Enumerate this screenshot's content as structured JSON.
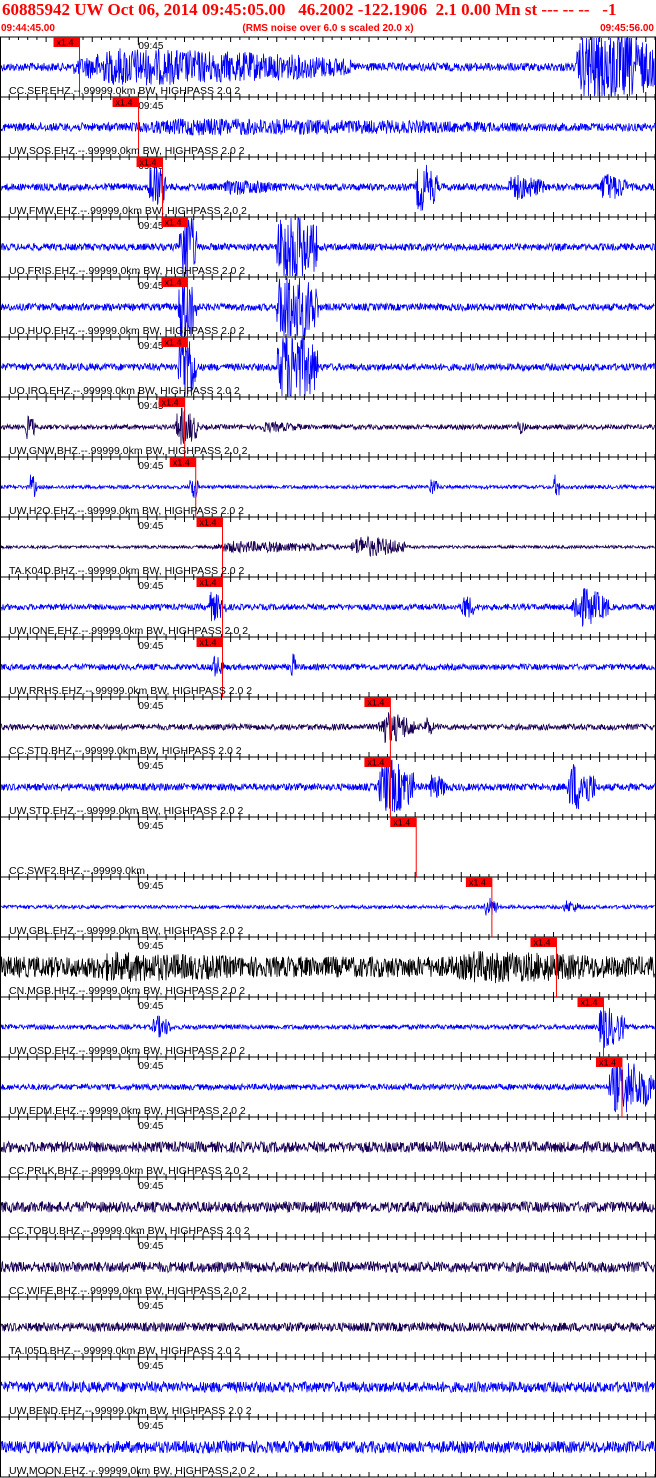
{
  "header": {
    "title": "60885942 UW Oct 06, 2014 09:45:05.00   46.2002 -122.1906  2.1 0.00 Mn st --- -- --   -1",
    "start_time": "09:44:45.00",
    "rms_note": "(RMS noise over 6.0 s scaled 20.0 x)",
    "end_time": "09:45:56.00"
  },
  "colors": {
    "header_text": "#ff0000",
    "pick_marker": "#ff0000",
    "axis": "#000000"
  },
  "chart_data": {
    "type": "line",
    "x_range_seconds": [
      0,
      71
    ],
    "minute_mark_label": "09:45",
    "minute_mark_seconds": 15,
    "pick_label": "x1.4",
    "traces": [
      {
        "label": "CC.SEP.EHZ.--.99999.0km BW, HIGHPASS  2.0  2",
        "color": "#0000ff",
        "pick_s": 5.8,
        "baseline_amp": 0.14,
        "bursts": [
          {
            "t": 8,
            "dur": 30,
            "amp": 0.7
          },
          {
            "t": 62.5,
            "dur": 8.5,
            "amp": 1.6
          }
        ]
      },
      {
        "label": "UW.SOS.EHZ.--.99999.0km BW, HIGHPASS  2.0  2",
        "color": "#0000ff",
        "pick_s": 12.2,
        "baseline_amp": 0.14,
        "bursts": [
          {
            "t": 13,
            "dur": 45,
            "amp": 0.32
          }
        ]
      },
      {
        "label": "UW.FMW.EHZ.--.99999.0km BW, HIGHPASS  2.0  2",
        "color": "#0000ff",
        "pick_s": 14.8,
        "baseline_amp": 0.12,
        "bursts": [
          {
            "t": 16,
            "dur": 2,
            "amp": 1.0
          },
          {
            "t": 24,
            "dur": 7,
            "amp": 0.3
          },
          {
            "t": 45,
            "dur": 2.5,
            "amp": 0.95
          },
          {
            "t": 55,
            "dur": 4,
            "amp": 0.5
          },
          {
            "t": 65,
            "dur": 3,
            "amp": 0.55
          }
        ]
      },
      {
        "label": "UO.FRIS.EHZ.--.99999.0km BW, HIGHPASS  2.0  2",
        "color": "#0000ff",
        "pick_s": 17.5,
        "baseline_amp": 0.12,
        "bursts": [
          {
            "t": 19.3,
            "dur": 2,
            "amp": 1.6
          },
          {
            "t": 30,
            "dur": 4.5,
            "amp": 1.6
          }
        ]
      },
      {
        "label": "UO.HUO.EHZ.--.99999.0km BW, HIGHPASS  2.0  2",
        "color": "#0000ff",
        "pick_s": 17.5,
        "baseline_amp": 0.12,
        "bursts": [
          {
            "t": 19.3,
            "dur": 2,
            "amp": 1.6
          },
          {
            "t": 30,
            "dur": 4.5,
            "amp": 1.6
          }
        ]
      },
      {
        "label": "UO.IRO.EHZ.--.99999.0km BW, HIGHPASS  2.0  2",
        "color": "#0000ff",
        "pick_s": 17.5,
        "baseline_amp": 0.12,
        "bursts": [
          {
            "t": 19.3,
            "dur": 2,
            "amp": 1.6
          },
          {
            "t": 30,
            "dur": 4.5,
            "amp": 1.6
          }
        ]
      },
      {
        "label": "UW.GNW.BHZ.--.99999.0km BW, HIGHPASS  2.0  2",
        "color": "#1a0055",
        "pick_s": 17.2,
        "baseline_amp": 0.08,
        "bursts": [
          {
            "t": 2.8,
            "dur": 1,
            "amp": 0.5
          },
          {
            "t": 19,
            "dur": 2.5,
            "amp": 0.75
          },
          {
            "t": 28,
            "dur": 5,
            "amp": 0.2
          },
          {
            "t": 56,
            "dur": 1,
            "amp": 0.3
          }
        ]
      },
      {
        "label": "UW.H2O.EHZ.--.99999.0km BW, HIGHPASS  2.0  2",
        "color": "#0000ff",
        "pick_s": 18.4,
        "baseline_amp": 0.06,
        "bursts": [
          {
            "t": 3.2,
            "dur": 0.8,
            "amp": 0.5
          },
          {
            "t": 20.5,
            "dur": 1,
            "amp": 0.55
          },
          {
            "t": 46.5,
            "dur": 1,
            "amp": 0.35
          },
          {
            "t": 60,
            "dur": 0.8,
            "amp": 0.45
          }
        ]
      },
      {
        "label": "TA.K04D.BHZ.--.99999.0km BW, HIGHPASS  2.0  2",
        "color": "#1a0055",
        "pick_s": 21.3,
        "baseline_amp": 0.05,
        "bursts": [
          {
            "t": 23,
            "dur": 14,
            "amp": 0.22
          },
          {
            "t": 38,
            "dur": 6,
            "amp": 0.4
          }
        ]
      },
      {
        "label": "UW.IONE.EHZ.--.99999.0km BW, HIGHPASS  2.0  2",
        "color": "#0000ff",
        "pick_s": 21.3,
        "baseline_amp": 0.1,
        "bursts": [
          {
            "t": 22.5,
            "dur": 2,
            "amp": 0.55
          },
          {
            "t": 50,
            "dur": 1.5,
            "amp": 0.5
          },
          {
            "t": 62,
            "dur": 4,
            "amp": 0.75
          }
        ]
      },
      {
        "label": "UW.RRHS.EHZ.--.99999.0km BW, HIGHPASS  2.0  2",
        "color": "#0000ff",
        "pick_s": 21.3,
        "baseline_amp": 0.1,
        "bursts": [
          {
            "t": 22.8,
            "dur": 1.5,
            "amp": 0.45
          },
          {
            "t": 31.5,
            "dur": 0.6,
            "amp": 0.6
          }
        ]
      },
      {
        "label": "CC.STD.BHZ.--.99999.0km BW, HIGHPASS  2.0  2",
        "color": "#1a0055",
        "pick_s": 39.5,
        "baseline_amp": 0.1,
        "bursts": [
          {
            "t": 41,
            "dur": 4,
            "amp": 0.6
          },
          {
            "t": 46,
            "dur": 1,
            "amp": 0.4
          }
        ]
      },
      {
        "label": "UW.STD.EHZ.--.99999.0km BW, HIGHPASS  2.0  2",
        "color": "#0000ff",
        "pick_s": 39.5,
        "baseline_amp": 0.12,
        "bursts": [
          {
            "t": 41,
            "dur": 4,
            "amp": 1.1
          },
          {
            "t": 46.5,
            "dur": 2,
            "amp": 0.5
          },
          {
            "t": 61.5,
            "dur": 3,
            "amp": 0.95
          }
        ]
      },
      {
        "label": "CC.SWF2.BHZ.--.99999.0km",
        "color": "#1a0055",
        "pick_s": 42.3,
        "baseline_amp": 0.0,
        "bursts": []
      },
      {
        "label": "UW.GBL.EHZ.--.99999.0km BW, HIGHPASS  2.0  2",
        "color": "#0000ff",
        "pick_s": 50.5,
        "baseline_amp": 0.06,
        "bursts": [
          {
            "t": 52.5,
            "dur": 1.5,
            "amp": 0.4
          },
          {
            "t": 61,
            "dur": 2,
            "amp": 0.25
          }
        ]
      },
      {
        "label": "CN.MGB.HHZ.--.99999.0km BW, HIGHPASS  2.0  2",
        "color": "#000000",
        "pick_s": 57.5,
        "baseline_amp": 0.35,
        "bursts": [
          {
            "t": 8,
            "dur": 25,
            "amp": 0.55
          },
          {
            "t": 48,
            "dur": 23,
            "amp": 0.6
          }
        ]
      },
      {
        "label": "UW.OSD.EHZ.--.99999.0km BW, HIGHPASS  2.0  2",
        "color": "#0000ff",
        "pick_s": 62.6,
        "baseline_amp": 0.08,
        "bursts": [
          {
            "t": 16.5,
            "dur": 2,
            "amp": 0.45
          },
          {
            "t": 64.8,
            "dur": 3,
            "amp": 0.8
          }
        ]
      },
      {
        "label": "UW.EDM.EHZ.--.99999.0km BW, HIGHPASS  2.0  2",
        "color": "#0000ff",
        "pick_s": 64.6,
        "baseline_amp": 0.1,
        "bursts": [
          {
            "t": 66,
            "dur": 5,
            "amp": 1.1
          }
        ]
      },
      {
        "label": "CC.PRLK.BHZ.--.99999.0km BW, HIGHPASS  2.0  2",
        "color": "#1a0055",
        "pick_s": null,
        "baseline_amp": 0.18,
        "bursts": []
      },
      {
        "label": "CC.TOBU.BHZ.--.99999.0km BW, HIGHPASS  2.0  2",
        "color": "#1a0055",
        "pick_s": null,
        "baseline_amp": 0.18,
        "bursts": []
      },
      {
        "label": "CC.WIFE.BHZ.--.99999.0km BW, HIGHPASS  2.0  2",
        "color": "#1a0055",
        "pick_s": null,
        "baseline_amp": 0.18,
        "bursts": []
      },
      {
        "label": "TA.I05D.BHZ.--.99999.0km BW, HIGHPASS  2.0  2",
        "color": "#1a0055",
        "pick_s": null,
        "baseline_amp": 0.15,
        "bursts": []
      },
      {
        "label": "UW.BEND.EHZ.--.99999.0km BW, HIGHPASS  2.0  2",
        "color": "#0000ff",
        "pick_s": null,
        "baseline_amp": 0.18,
        "bursts": []
      },
      {
        "label": "UW.MOON.EHZ.--.99999.0km BW, HIGHPASS  2.0  2",
        "color": "#0000ff",
        "pick_s": null,
        "baseline_amp": 0.2,
        "bursts": []
      }
    ]
  }
}
